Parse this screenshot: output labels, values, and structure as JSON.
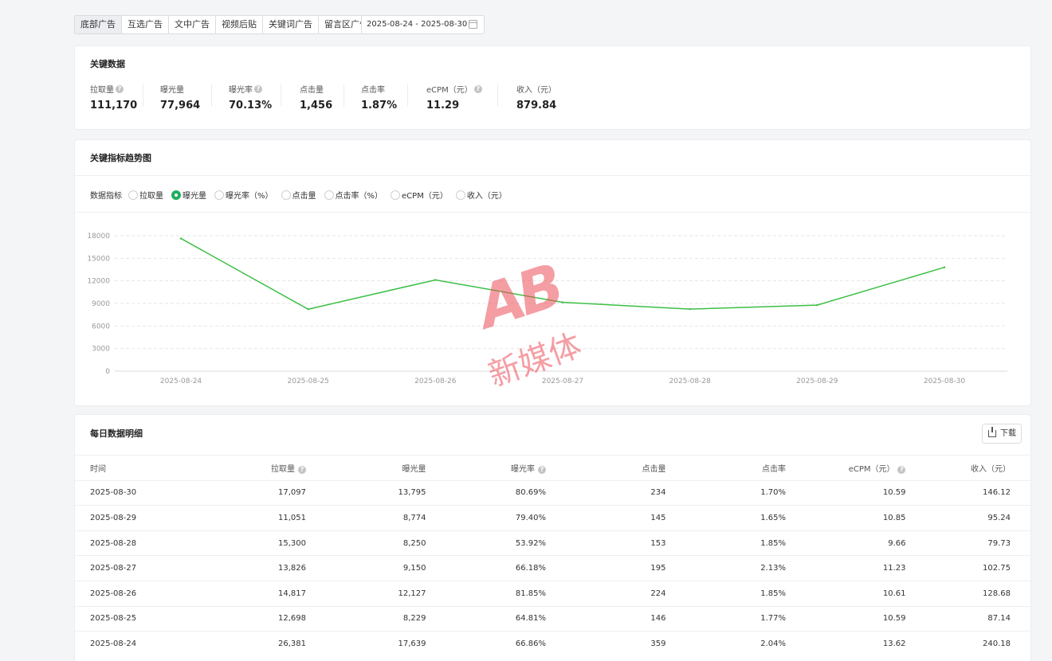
{
  "tabs": [
    {
      "label": "底部广告",
      "active": true
    },
    {
      "label": "互选广告",
      "active": false
    },
    {
      "label": "文中广告",
      "active": false
    },
    {
      "label": "视频后贴",
      "active": false
    },
    {
      "label": "关键词广告",
      "active": false
    },
    {
      "label": "留言区广告",
      "active": false
    }
  ],
  "date_range": "2025-08-24 - 2025-08-30",
  "key_data": {
    "title": "关键数据",
    "metrics": [
      {
        "label": "拉取量",
        "value": "111,170",
        "help": true
      },
      {
        "label": "曝光量",
        "value": "77,964",
        "help": false
      },
      {
        "label": "曝光率",
        "value": "70.13%",
        "help": true
      },
      {
        "label": "点击量",
        "value": "1,456",
        "help": false
      },
      {
        "label": "点击率",
        "value": "1.87%",
        "help": false
      },
      {
        "label": "eCPM（元）",
        "value": "11.29",
        "help": true
      },
      {
        "label": "收入（元）",
        "value": "879.84",
        "help": false
      }
    ]
  },
  "trend": {
    "title": "关键指标趋势图",
    "selector_label": "数据指标",
    "options": [
      {
        "label": "拉取量",
        "checked": false
      },
      {
        "label": "曝光量",
        "checked": true
      },
      {
        "label": "曝光率（%）",
        "checked": false
      },
      {
        "label": "点击量",
        "checked": false
      },
      {
        "label": "点击率（%）",
        "checked": false
      },
      {
        "label": "eCPM（元）",
        "checked": false
      },
      {
        "label": "收入（元）",
        "checked": false
      }
    ]
  },
  "chart_data": {
    "type": "line",
    "categories": [
      "2025-08-24",
      "2025-08-25",
      "2025-08-26",
      "2025-08-27",
      "2025-08-28",
      "2025-08-29",
      "2025-08-30"
    ],
    "series": [
      {
        "values": [
          17639,
          8229,
          12127,
          9150,
          8250,
          8774,
          13795
        ],
        "color": "#3cbf45"
      }
    ],
    "yticks": [
      0,
      3000,
      6000,
      9000,
      12000,
      15000,
      18000
    ],
    "ylim": [
      0,
      18000
    ],
    "grid": true
  },
  "watermark": {
    "logo": "AB",
    "text": "新媒体"
  },
  "daily": {
    "title": "每日数据明细",
    "download_label": "下载",
    "columns": [
      {
        "label": "时间",
        "help": false
      },
      {
        "label": "拉取量",
        "help": true
      },
      {
        "label": "曝光量",
        "help": false
      },
      {
        "label": "曝光率",
        "help": true
      },
      {
        "label": "点击量",
        "help": false
      },
      {
        "label": "点击率",
        "help": false
      },
      {
        "label": "eCPM（元）",
        "help": true
      },
      {
        "label": "收入（元）",
        "help": false
      }
    ],
    "rows": [
      [
        "2025-08-30",
        "17,097",
        "13,795",
        "80.69%",
        "234",
        "1.70%",
        "10.59",
        "146.12"
      ],
      [
        "2025-08-29",
        "11,051",
        "8,774",
        "79.40%",
        "145",
        "1.65%",
        "10.85",
        "95.24"
      ],
      [
        "2025-08-28",
        "15,300",
        "8,250",
        "53.92%",
        "153",
        "1.85%",
        "9.66",
        "79.73"
      ],
      [
        "2025-08-27",
        "13,826",
        "9,150",
        "66.18%",
        "195",
        "2.13%",
        "11.23",
        "102.75"
      ],
      [
        "2025-08-26",
        "14,817",
        "12,127",
        "81.85%",
        "224",
        "1.85%",
        "10.61",
        "128.68"
      ],
      [
        "2025-08-25",
        "12,698",
        "8,229",
        "64.81%",
        "146",
        "1.77%",
        "10.59",
        "87.14"
      ],
      [
        "2025-08-24",
        "26,381",
        "17,639",
        "66.86%",
        "359",
        "2.04%",
        "13.62",
        "240.18"
      ]
    ]
  }
}
